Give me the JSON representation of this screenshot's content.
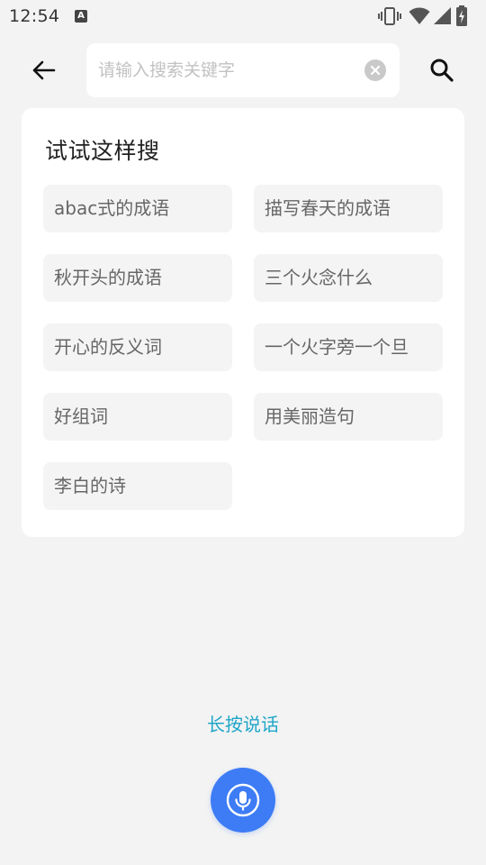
{
  "status_bar": {
    "time": "12:54",
    "notification_icon": "A",
    "icons": [
      "vibrate-icon",
      "wifi-icon",
      "signal-icon",
      "battery-charging-icon"
    ]
  },
  "header": {
    "back_icon": "arrow-left-icon",
    "search": {
      "placeholder": "请输入搜索关键字",
      "value": ""
    },
    "clear_icon": "clear-circle-icon",
    "search_icon": "magnifier-icon"
  },
  "suggestions": {
    "title": "试试这样搜",
    "items": [
      "abac式的成语",
      "描写春天的成语",
      "秋开头的成语",
      "三个火念什么",
      "开心的反义词",
      "一个火字旁一个旦",
      "好组词",
      "用美丽造句",
      "李白的诗"
    ]
  },
  "voice": {
    "hint": "长按说话",
    "mic_icon": "microphone-icon"
  },
  "colors": {
    "background": "#f3f3f3",
    "card": "#ffffff",
    "chip": "#f4f4f4",
    "hint_text": "#1fa6c9",
    "mic_button": "#3d7cf5"
  }
}
